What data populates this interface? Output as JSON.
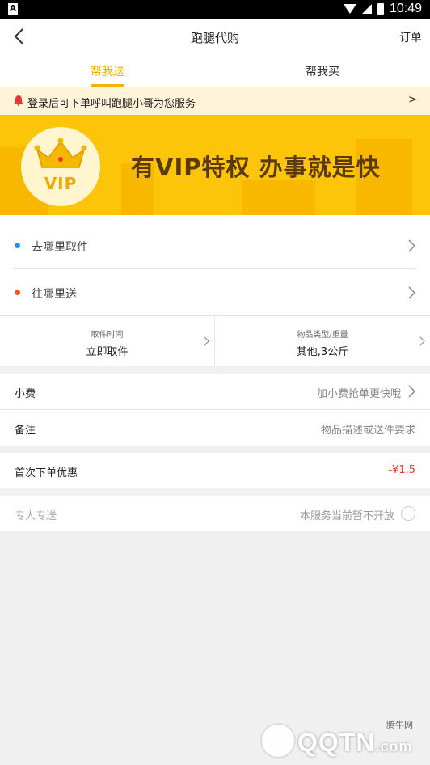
{
  "status_bar": {
    "time": "10:49",
    "left_icon": "A"
  },
  "nav": {
    "title": "跑腿代购",
    "orders_label": "订单"
  },
  "tabs": [
    {
      "label": "帮我送",
      "active": true
    },
    {
      "label": "帮我买",
      "active": false
    }
  ],
  "notice": {
    "text": "登录后可下单呼叫跑腿小哥为您服务",
    "arrow": ">"
  },
  "banner": {
    "badge_text": "VIP",
    "slogan": "有VIP特权  办事就是快"
  },
  "address": {
    "pickup_label": "去哪里取件",
    "pickup_dot_color": "#2f8ff0",
    "dropoff_label": "往哪里送",
    "dropoff_dot_color": "#f05a14"
  },
  "pickup_time": {
    "label": "取件时间",
    "value": "立即取件"
  },
  "item_type": {
    "label": "物品类型/重量",
    "value": "其他,3公斤"
  },
  "tip": {
    "label": "小费",
    "value": "加小费抢单更快哦"
  },
  "remark": {
    "label": "备注",
    "placeholder": "物品描述或送件要求"
  },
  "first_order": {
    "label": "首次下单优惠",
    "value": "-¥1.5",
    "value_color": "#e53935"
  },
  "dedicated": {
    "label": "专人专送",
    "value": "本服务当前暂不开放"
  },
  "watermark": {
    "text": "QQTN",
    "suffix": ".com",
    "site": "腾牛网"
  },
  "colors": {
    "accent": "#f2b400",
    "banner": "#fdc50a",
    "notice_bg": "#fdf4d9"
  }
}
